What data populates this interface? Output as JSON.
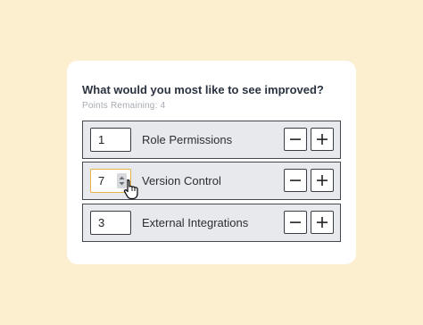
{
  "survey": {
    "question": "What would you most like to see improved?",
    "points_label": "Points Remaining:",
    "points_remaining": "4",
    "items": [
      {
        "label": "Role Permissions",
        "value": "1"
      },
      {
        "label": "Version Control",
        "value": "7"
      },
      {
        "label": "External Integrations",
        "value": "3"
      }
    ]
  },
  "colors": {
    "background": "#fcefcf",
    "card": "#ffffff",
    "row_fill": "#e8e9ec",
    "focus_border": "#e3b445"
  },
  "icons": {
    "decrement": "minus-icon",
    "increment": "plus-icon",
    "spinner": "spinner-arrows-icon",
    "cursor": "hand-pointer-cursor-icon"
  }
}
